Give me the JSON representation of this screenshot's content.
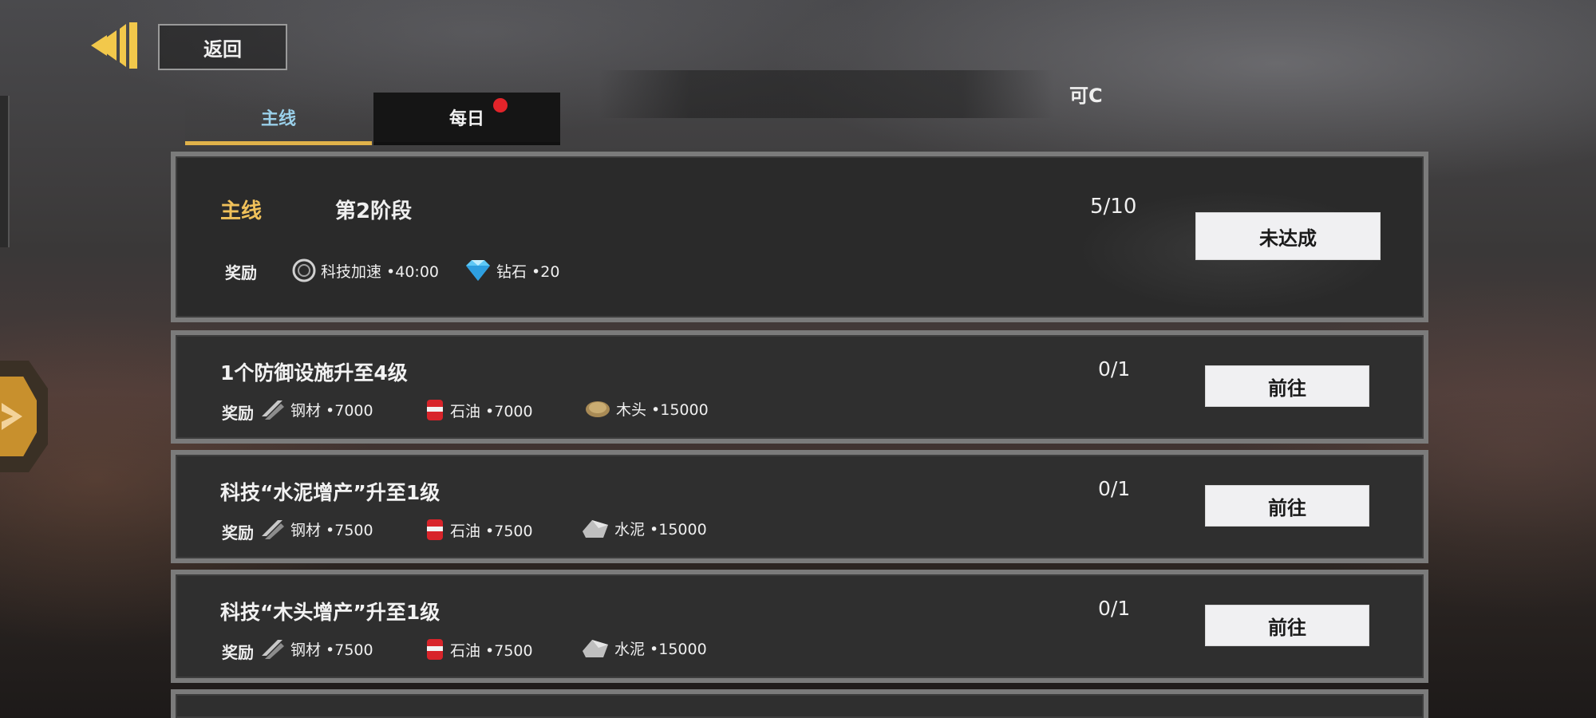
{
  "header": {
    "back_icon": "back-arrow-icon",
    "title": "返回",
    "hint": "可C"
  },
  "tabs": [
    {
      "label": "主线",
      "active": true
    },
    {
      "label": "每日",
      "active": false,
      "badge": "red-dot"
    }
  ],
  "main_quest": {
    "kind": "主线",
    "stage": "第2阶段",
    "progress": "5/10",
    "reward_label": "奖励",
    "rewards": [
      {
        "icon": "coin-icon",
        "text": "科技加速 •40:00"
      },
      {
        "icon": "diamond-icon",
        "text": "钻石 •20"
      }
    ],
    "button": "未达成"
  },
  "tasks": [
    {
      "title": "1个防御设施升至4级",
      "progress": "0/1",
      "button": "前往",
      "reward_label": "奖励",
      "rewards": [
        {
          "icon": "steel-icon",
          "text": "钢材 •7000"
        },
        {
          "icon": "oil-icon",
          "text": "石油 •7000"
        },
        {
          "icon": "wood-icon",
          "text": "木头 •15000"
        }
      ]
    },
    {
      "title": "科技“水泥增产”升至1级",
      "progress": "0/1",
      "button": "前往",
      "reward_label": "奖励",
      "rewards": [
        {
          "icon": "steel-icon",
          "text": "钢材 •7500"
        },
        {
          "icon": "oil-icon",
          "text": "石油 •7500"
        },
        {
          "icon": "cement-icon",
          "text": "水泥 •15000"
        }
      ]
    },
    {
      "title": "科技“木头增产”升至1级",
      "progress": "0/1",
      "button": "前往",
      "reward_label": "奖励",
      "rewards": [
        {
          "icon": "steel-icon",
          "text": "钢材 •7500"
        },
        {
          "icon": "oil-icon",
          "text": "石油 •7500"
        },
        {
          "icon": "cement-icon",
          "text": "水泥 •15000"
        }
      ]
    }
  ],
  "colors": {
    "accent_gold": "#f0c15a",
    "tab_active_text": "#9ad0ea",
    "badge_red": "#e2242a",
    "panel_border": "#7b7b7b"
  }
}
